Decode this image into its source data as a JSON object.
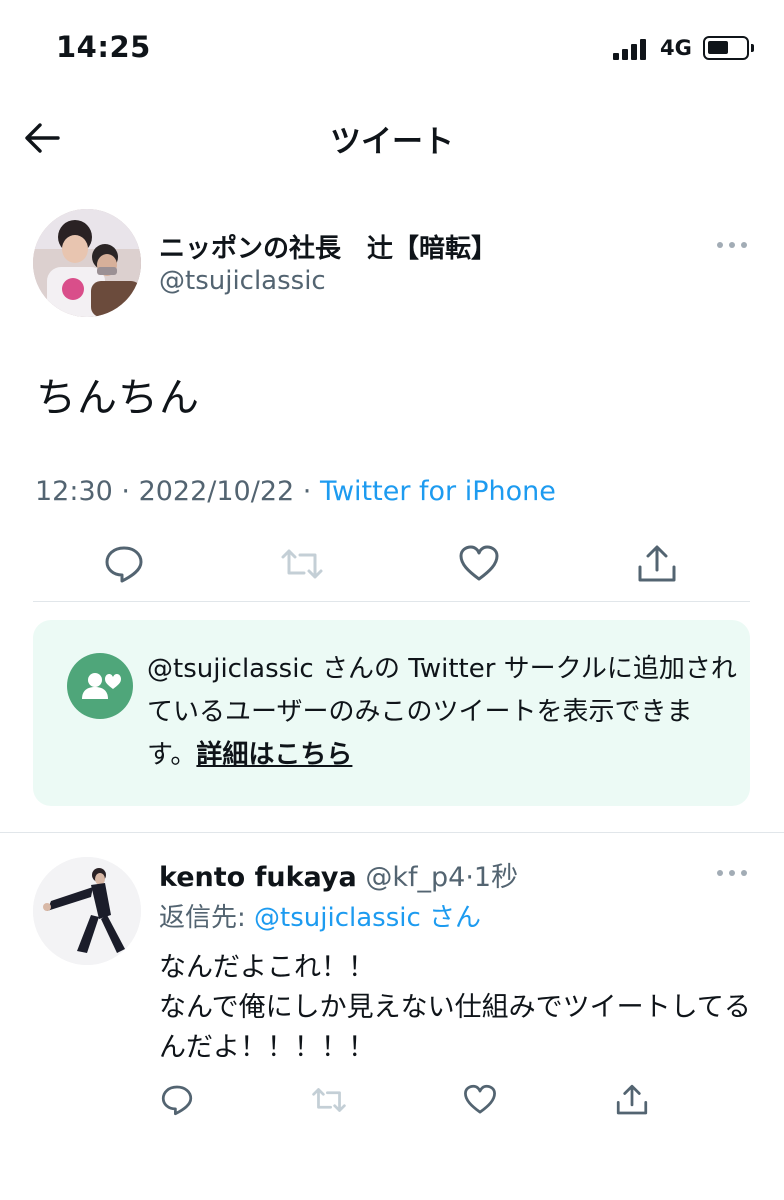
{
  "status_bar": {
    "time": "14:25",
    "network": "4G",
    "battery_percent": 45
  },
  "header": {
    "title": "ツイート"
  },
  "tweet": {
    "author_name": "ニッポンの社長　辻【暗転】",
    "author_handle": "@tsujiclassic",
    "text": "ちんちん",
    "time": "12:30",
    "date": "2022/10/22",
    "separator": " · ",
    "source": "Twitter for iPhone",
    "avatar": "avatar-photo"
  },
  "circle_notice": {
    "icon": "twitter-circle-icon",
    "message": "@tsujiclassic さんの Twitter サークルに追加されているユーザーのみこのツイートを表示できます。",
    "link_text": "詳細はこちら"
  },
  "reply": {
    "author_name": "kento fukaya",
    "author_handle": "@kf_p4",
    "separator": "·",
    "time_ago": "1秒",
    "reply_to_label": "返信先: ",
    "reply_to_handle": "@tsujiclassic",
    "reply_to_suffix": "さん",
    "lines": [
      "なんだよこれ！！",
      "なんで俺にしか見えない仕組みでツイートしてるんだよ！！！！！"
    ]
  },
  "colors": {
    "link_blue": "#1d9bf0",
    "secondary_gray": "#536471",
    "circle_bg": "#ecfaf5",
    "circle_green": "#4fa67a",
    "icon_gray": "#536471",
    "disabled_gray": "#c4cfd6"
  },
  "actions": [
    "reply-icon",
    "retweet-icon",
    "like-icon",
    "share-icon"
  ]
}
